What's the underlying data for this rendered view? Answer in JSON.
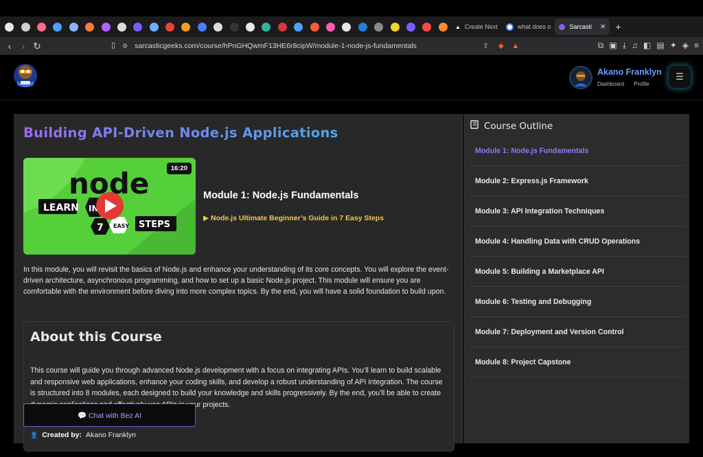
{
  "browser": {
    "tabs": [
      {
        "label": "Create Next",
        "active": false
      },
      {
        "label": "what does o",
        "active": false
      },
      {
        "label": "Sarcasti",
        "active": true
      }
    ],
    "pinned_colors": [
      "#e8e8e8",
      "#cfcfcf",
      "#ff6a8a",
      "#4aa3ff",
      "#8ab4ff",
      "#ff7a3a",
      "#b062ff",
      "#dddddd",
      "#7a5cff",
      "#6ab0ff",
      "#ea4335",
      "#f0a020",
      "#4a7bff",
      "#dddddd",
      "#333333",
      "#e8e8e8",
      "#2fb5a0",
      "#d33b3b",
      "#4aa3ff",
      "#ff5a3a",
      "#ff5ab4",
      "#e8e8e8",
      "#2a7ad8",
      "#888888",
      "#f6d32d",
      "#7a5cff",
      "#ff4a4a",
      "#ff8a3a"
    ],
    "new_tab": "+",
    "url": "sarcasticgeeks.com/course/hPnGHQwmF13HE6r8cipW/module-1-node-js-fundamentals"
  },
  "header": {
    "user_name": "Akano Franklyn",
    "links": [
      "Dashboard",
      "Profile"
    ],
    "menu_icon": "hamburger-icon"
  },
  "course": {
    "title": "Building API-Driven Node.js Applications",
    "thumbnail": {
      "duration": "16:20",
      "word_node": "node",
      "learn": "LEARN",
      "in": "IN",
      "seven": "7",
      "easy": "EASY",
      "steps": "STEPS"
    },
    "module_heading": "Module 1: Node.js Fundamentals",
    "video_link": "▶ Node.js Ultimate Beginner’s Guide in 7 Easy Steps",
    "module_description": "In this module, you will revisit the basics of Node.js and enhance your understanding of its core concepts. You will explore the event-driven architecture, asynchronous programming, and how to set up a basic Node.js project. This module will ensure you are comfortable with the environment before diving into more complex topics. By the end, you will have a solid foundation to build upon.",
    "about": {
      "title": "About this Course",
      "text": "This course will guide you through advanced Node.js development with a focus on integrating APIs. You’ll learn to build scalable and responsive web applications, enhance your coding skills, and develop a robust understanding of API integration. The course is structured into 8 modules, each designed to build your knowledge and skills progressively. By the end, you’ll be able to create dynamic applications and effectively use APIs in your projects.",
      "created_label": "Created by:",
      "created_by": "Akano Franklyn"
    },
    "chat_button": "💬 Chat with Bez AI"
  },
  "outline": {
    "title": "Course Outline",
    "modules": [
      {
        "label": "Module 1: Node.js Fundamentals",
        "active": true
      },
      {
        "label": "Module 2: Express.js Framework",
        "active": false
      },
      {
        "label": "Module 3: API Integration Techniques",
        "active": false
      },
      {
        "label": "Module 4: Handling Data with CRUD Operations",
        "active": false
      },
      {
        "label": "Module 5: Building a Marketplace API",
        "active": false
      },
      {
        "label": "Module 6: Testing and Debugging",
        "active": false
      },
      {
        "label": "Module 7: Deployment and Version Control",
        "active": false
      },
      {
        "label": "Module 8: Project Capstone",
        "active": false
      }
    ]
  }
}
